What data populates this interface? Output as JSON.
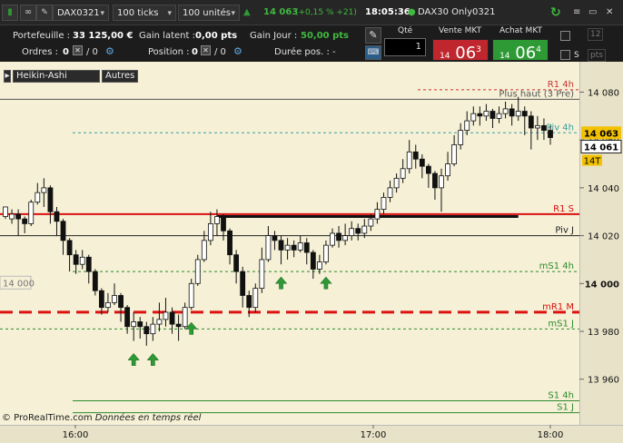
{
  "toolbar": {
    "instrument": "DAX0321",
    "timeframe": "100 ticks",
    "units": "100 unités",
    "last_price": "14 063",
    "change": "(+0,15 % +21)",
    "time": "18:05:36",
    "feed": "DAX30 Only0321"
  },
  "info": {
    "portefeuille_label": "Portefeuille :",
    "portefeuille_value": "33 125,00 €",
    "latent_label": "Gain latent :",
    "latent_value": "0,00 pts",
    "gainjour_label": "Gain Jour :",
    "gainjour_value": "50,00 pts",
    "ordres_label": "Ordres :",
    "ordres_value": "0",
    "ordres_sep": "/ 0",
    "position_label": "Position :",
    "position_value": "0",
    "position_sep": "/ 0",
    "duree_label": "Durée pos. :",
    "duree_value": "-"
  },
  "order": {
    "qty_label": "Qté",
    "qty_value": "1",
    "sell_label": "Vente MKT",
    "sell_prefix": "14",
    "sell_price": "06",
    "sell_sup": "3",
    "buy_label": "Achat MKT",
    "buy_prefix": "14",
    "buy_price": "06",
    "buy_sup": "4",
    "check1": "12",
    "check2": "S",
    "check2_value": "pts"
  },
  "chart_tabs": [
    "Heikin-Ashi",
    "Autres"
  ],
  "watermark": "© ProRealTime.com",
  "watermark2": "Données en temps réel",
  "chart_data": {
    "type": "candlestick",
    "style": "Heikin-Ashi",
    "y_ticks": [
      "14 080",
      "14 060",
      "14 040",
      "14 020",
      "14 000",
      "13 980",
      "13 960"
    ],
    "ylim": [
      13947,
      14087
    ],
    "x_ticks": [
      "16:00",
      "17:00",
      "18:00"
    ],
    "price_tags": {
      "last": "14 063",
      "current": "14 061",
      "tt": "14T"
    },
    "left_tag": "14 000",
    "levels": [
      {
        "label": "R1 4h",
        "value": 14081,
        "color": "#cc3333",
        "style": "dashed"
      },
      {
        "label": "Plus haut (3 Pre)",
        "value": 14077,
        "color": "#555555",
        "style": "solid"
      },
      {
        "label": "Piv 4h",
        "value": 14063,
        "color": "#3aa0a0",
        "style": "dashed"
      },
      {
        "label": "R1 S",
        "value": 14029,
        "color": "#dd1111",
        "style": "solid"
      },
      {
        "label": "Piv J",
        "value": 14020,
        "color": "#222222",
        "style": "solid"
      },
      {
        "label": "mS1 4h",
        "value": 14005,
        "color": "#2e8b2e",
        "style": "dashed"
      },
      {
        "label": "mR1 M",
        "value": 13988,
        "color": "#dd1111",
        "style": "bigdash"
      },
      {
        "label": "mS1 J",
        "value": 13981,
        "color": "#2e8b2e",
        "style": "dashed"
      },
      {
        "label": "S1 4h",
        "value": 13951,
        "color": "#2e8b2e",
        "style": "solid"
      },
      {
        "label": "S1 J",
        "value": 13946,
        "color": "#2e8b2e",
        "style": "solid"
      }
    ],
    "resistance_segment": {
      "value": 14028,
      "from_index": 33,
      "to_index": 80
    },
    "buy_arrows": [
      20,
      23,
      29,
      43,
      50
    ],
    "candles": [
      [
        14028,
        14032,
        14030,
        14027
      ],
      [
        14027,
        14029,
        14031,
        14025
      ],
      [
        14029,
        14027,
        14031,
        14020
      ],
      [
        14027,
        14025,
        14028,
        14021
      ],
      [
        14025,
        14034,
        14035,
        14024
      ],
      [
        14034,
        14038,
        14042,
        14033
      ],
      [
        14038,
        14040,
        14044,
        14032
      ],
      [
        14040,
        14030,
        14041,
        14025
      ],
      [
        14030,
        14026,
        14032,
        14020
      ],
      [
        14026,
        14018,
        14027,
        14012
      ],
      [
        14018,
        14012,
        14019,
        14005
      ],
      [
        14012,
        14008,
        14014,
        14004
      ],
      [
        14008,
        14011,
        14014,
        14006
      ],
      [
        14011,
        14005,
        14012,
        14000
      ],
      [
        14005,
        13997,
        14006,
        13995
      ],
      [
        13997,
        13990,
        13998,
        13987
      ],
      [
        13990,
        13992,
        13996,
        13988
      ],
      [
        13992,
        13995,
        14000,
        13991
      ],
      [
        13995,
        13990,
        13996,
        13984
      ],
      [
        13990,
        13982,
        13991,
        13979
      ],
      [
        13982,
        13984,
        13988,
        13976
      ],
      [
        13984,
        13982,
        13986,
        13977
      ],
      [
        13982,
        13979,
        13984,
        13974
      ],
      [
        13979,
        13983,
        13986,
        13976
      ],
      [
        13983,
        13985,
        13992,
        13980
      ],
      [
        13985,
        13988,
        13994,
        13982
      ],
      [
        13988,
        13983,
        13990,
        13979
      ],
      [
        13983,
        13982,
        13987,
        13976
      ],
      [
        13982,
        13990,
        13992,
        13981
      ],
      [
        13990,
        14000,
        14002,
        13989
      ],
      [
        14000,
        14010,
        14012,
        13999
      ],
      [
        14010,
        14018,
        14022,
        14009
      ],
      [
        14018,
        14025,
        14030,
        14016
      ],
      [
        14025,
        14028,
        14031,
        14020
      ],
      [
        14028,
        14022,
        14029,
        14018
      ],
      [
        14022,
        14012,
        14023,
        14008
      ],
      [
        14012,
        14005,
        14014,
        14000
      ],
      [
        14005,
        13995,
        14007,
        13990
      ],
      [
        13995,
        13990,
        13997,
        13986
      ],
      [
        13990,
        13998,
        14000,
        13988
      ],
      [
        13998,
        14010,
        14015,
        13996
      ],
      [
        14010,
        14020,
        14024,
        14009
      ],
      [
        14020,
        14018,
        14022,
        14014
      ],
      [
        14018,
        14014,
        14020,
        14008
      ],
      [
        14014,
        14016,
        14019,
        14010
      ],
      [
        14016,
        14014,
        14018,
        14011
      ],
      [
        14014,
        14017,
        14020,
        14013
      ],
      [
        14017,
        14013,
        14019,
        14008
      ],
      [
        14013,
        14006,
        14014,
        14002
      ],
      [
        14006,
        14009,
        14012,
        14004
      ],
      [
        14009,
        14016,
        14018,
        14008
      ],
      [
        14016,
        14021,
        14023,
        14015
      ],
      [
        14021,
        14018,
        14024,
        14015
      ],
      [
        14018,
        14020,
        14025,
        14016
      ],
      [
        14020,
        14023,
        14026,
        14018
      ],
      [
        14023,
        14021,
        14025,
        14018
      ],
      [
        14021,
        14024,
        14027,
        14019
      ],
      [
        14024,
        14027,
        14029,
        14022
      ],
      [
        14027,
        14031,
        14034,
        14025
      ],
      [
        14031,
        14036,
        14038,
        14029
      ],
      [
        14036,
        14040,
        14043,
        14034
      ],
      [
        14040,
        14044,
        14046,
        14038
      ],
      [
        14044,
        14048,
        14052,
        14042
      ],
      [
        14048,
        14055,
        14060,
        14046
      ],
      [
        14055,
        14052,
        14058,
        14048
      ],
      [
        14052,
        14049,
        14054,
        14044
      ],
      [
        14049,
        14046,
        14050,
        14040
      ],
      [
        14046,
        14040,
        14047,
        14035
      ],
      [
        14040,
        14045,
        14048,
        14030
      ],
      [
        14045,
        14050,
        14055,
        14043
      ],
      [
        14050,
        14058,
        14062,
        14049
      ],
      [
        14058,
        14064,
        14067,
        14056
      ],
      [
        14064,
        14068,
        14072,
        14062
      ],
      [
        14068,
        14071,
        14074,
        14066
      ],
      [
        14071,
        14070,
        14074,
        14066
      ],
      [
        14070,
        14072,
        14075,
        14068
      ],
      [
        14072,
        14069,
        14073,
        14065
      ],
      [
        14069,
        14071,
        14074,
        14067
      ],
      [
        14071,
        14073,
        14076,
        14069
      ],
      [
        14073,
        14070,
        14075,
        14066
      ],
      [
        14070,
        14072,
        14078,
        14068
      ],
      [
        14072,
        14070,
        14074,
        14062
      ],
      [
        14070,
        14065,
        14072,
        14056
      ],
      [
        14065,
        14066,
        14070,
        14060
      ],
      [
        14066,
        14064,
        14069,
        14060
      ],
      [
        14064,
        14061,
        14066,
        14058
      ]
    ]
  },
  "colors": {
    "background": "#f5f0d6",
    "sell": "#c0262d",
    "buy": "#2e9a35",
    "up": "#ffffff",
    "down": "#111111"
  }
}
